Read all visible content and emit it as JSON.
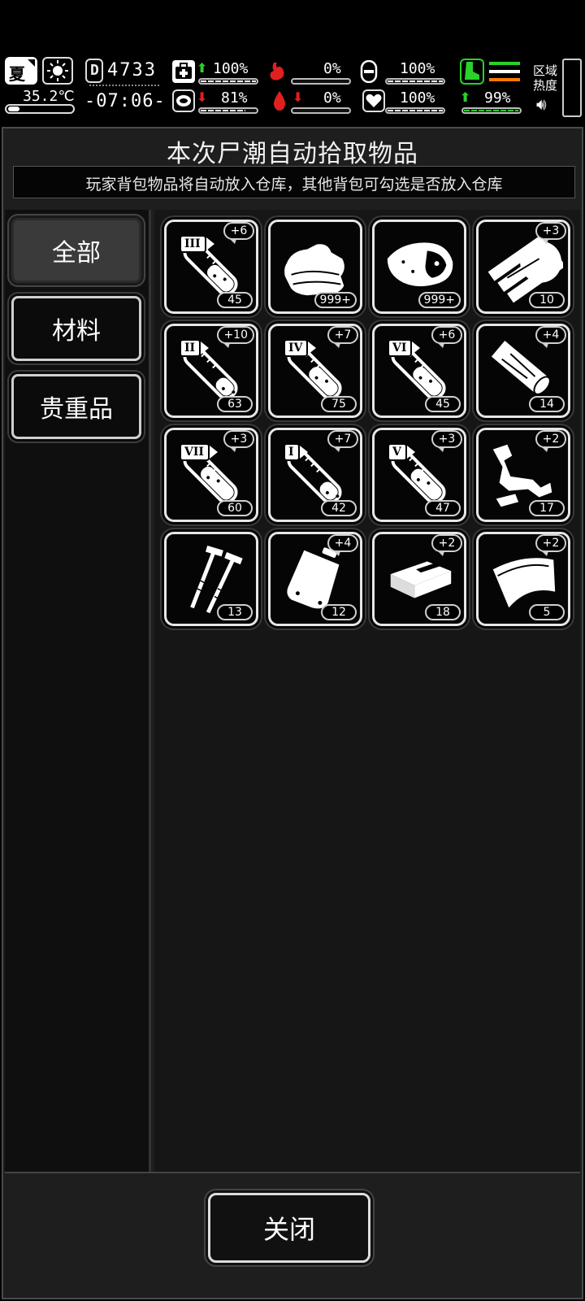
{
  "hud": {
    "season": "夏",
    "temperature": "35.2℃",
    "day": "4733",
    "time": "-07:06-",
    "stats": {
      "health": {
        "value": "100%",
        "level": 1.0,
        "trend": "up"
      },
      "hunger": {
        "value": "0%",
        "level": 0.0,
        "trend": "none"
      },
      "sanity": {
        "value": "100%",
        "level": 1.0,
        "trend": "none"
      },
      "stamina": {
        "value": "81%",
        "level": 0.81,
        "trend": "down"
      },
      "thirst": {
        "value": "0%",
        "level": 0.0,
        "trend": "down"
      },
      "mood": {
        "value": "100%",
        "level": 1.0,
        "trend": "none"
      },
      "speed": {
        "value": "99%",
        "level": 0.99,
        "trend": "up"
      }
    },
    "region_heat_label": "区域热度",
    "colors": {
      "up": "#2ad12a",
      "down": "#e02020",
      "accent_green": "#2ad12a",
      "accent_orange": "#ff7a00"
    }
  },
  "dialog": {
    "title": "本次尸潮自动拾取物品",
    "subtitle": "玩家背包物品将自动放入仓库，其他背包可勾选是否放入仓库",
    "tabs": [
      {
        "label": "全部",
        "active": true
      },
      {
        "label": "材料",
        "active": false
      },
      {
        "label": "贵重品",
        "active": false
      }
    ],
    "items": [
      {
        "icon": "vial-icon",
        "tier": "III",
        "bonus": "+6",
        "count": "45",
        "fill": 0.5
      },
      {
        "icon": "cloth-icon",
        "tier": "",
        "bonus": "",
        "count": "999+",
        "fill": 0
      },
      {
        "icon": "meat-icon",
        "tier": "",
        "bonus": "",
        "count": "999+",
        "fill": 0
      },
      {
        "icon": "wood-planks-icon",
        "tier": "",
        "bonus": "+3",
        "count": "10",
        "fill": 0
      },
      {
        "icon": "vial-icon",
        "tier": "II",
        "bonus": "+10",
        "count": "63",
        "fill": 0.3
      },
      {
        "icon": "vial-icon",
        "tier": "IV",
        "bonus": "+7",
        "count": "75",
        "fill": 0.55
      },
      {
        "icon": "vial-icon",
        "tier": "VI",
        "bonus": "+6",
        "count": "45",
        "fill": 0.55
      },
      {
        "icon": "log-icon",
        "tier": "",
        "bonus": "+4",
        "count": "14",
        "fill": 0
      },
      {
        "icon": "vial-icon",
        "tier": "VII",
        "bonus": "+3",
        "count": "60",
        "fill": 0.65
      },
      {
        "icon": "vial-icon",
        "tier": "I",
        "bonus": "+7",
        "count": "42",
        "fill": 0.3
      },
      {
        "icon": "vial-icon",
        "tier": "V",
        "bonus": "+3",
        "count": "47",
        "fill": 0.6
      },
      {
        "icon": "scrap-cloth-icon",
        "tier": "",
        "bonus": "+2",
        "count": "17",
        "fill": 0
      },
      {
        "icon": "nails-icon",
        "tier": "",
        "bonus": "",
        "count": "13",
        "fill": 0
      },
      {
        "icon": "bag-icon",
        "tier": "",
        "bonus": "+4",
        "count": "12",
        "fill": 0
      },
      {
        "icon": "brick-icon",
        "tier": "",
        "bonus": "+2",
        "count": "18",
        "fill": 0
      },
      {
        "icon": "fabric-sheet-icon",
        "tier": "",
        "bonus": "+2",
        "count": "5",
        "fill": 0
      }
    ],
    "close_label": "关闭"
  }
}
